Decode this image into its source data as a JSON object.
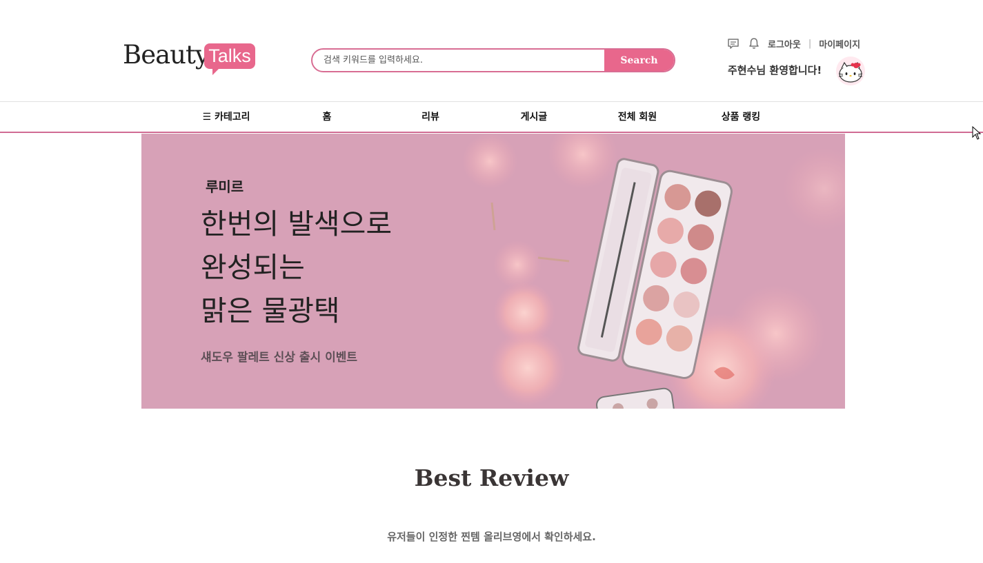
{
  "header": {
    "logo": {
      "word": "Beauty",
      "badge": "Talks"
    },
    "search": {
      "placeholder": "검색 키워드를 입력하세요.",
      "button_label": "Search"
    },
    "utils": {
      "logout_label": "로그아웃",
      "separator": "|",
      "mypage_label": "마이페이지"
    },
    "welcome_text": "주현수님 환영합니다!"
  },
  "nav": {
    "items": [
      {
        "label": "☰ 카테고리"
      },
      {
        "label": "홈"
      },
      {
        "label": "리뷰"
      },
      {
        "label": "게시글"
      },
      {
        "label": "전체 회원"
      },
      {
        "label": "상품 랭킹"
      }
    ]
  },
  "banner": {
    "brand": "루미르",
    "headline_lines": [
      "한번의 발색으로",
      "완성되는",
      "맑은 물광택"
    ],
    "subtitle": "섀도우 팔레트 신상 출시 이벤트"
  },
  "best_review": {
    "title": "Best Review",
    "subtitle": "유저들이 인정한 찐템 올리브영에서 확인하세요."
  },
  "icons": [
    "message-icon",
    "bell-icon",
    "avatar-hello-kitty",
    "cursor-icon"
  ],
  "colors": {
    "accent": "#e8678c",
    "nav_border": "#d06b93",
    "banner_bg": "#d7a1b7"
  }
}
